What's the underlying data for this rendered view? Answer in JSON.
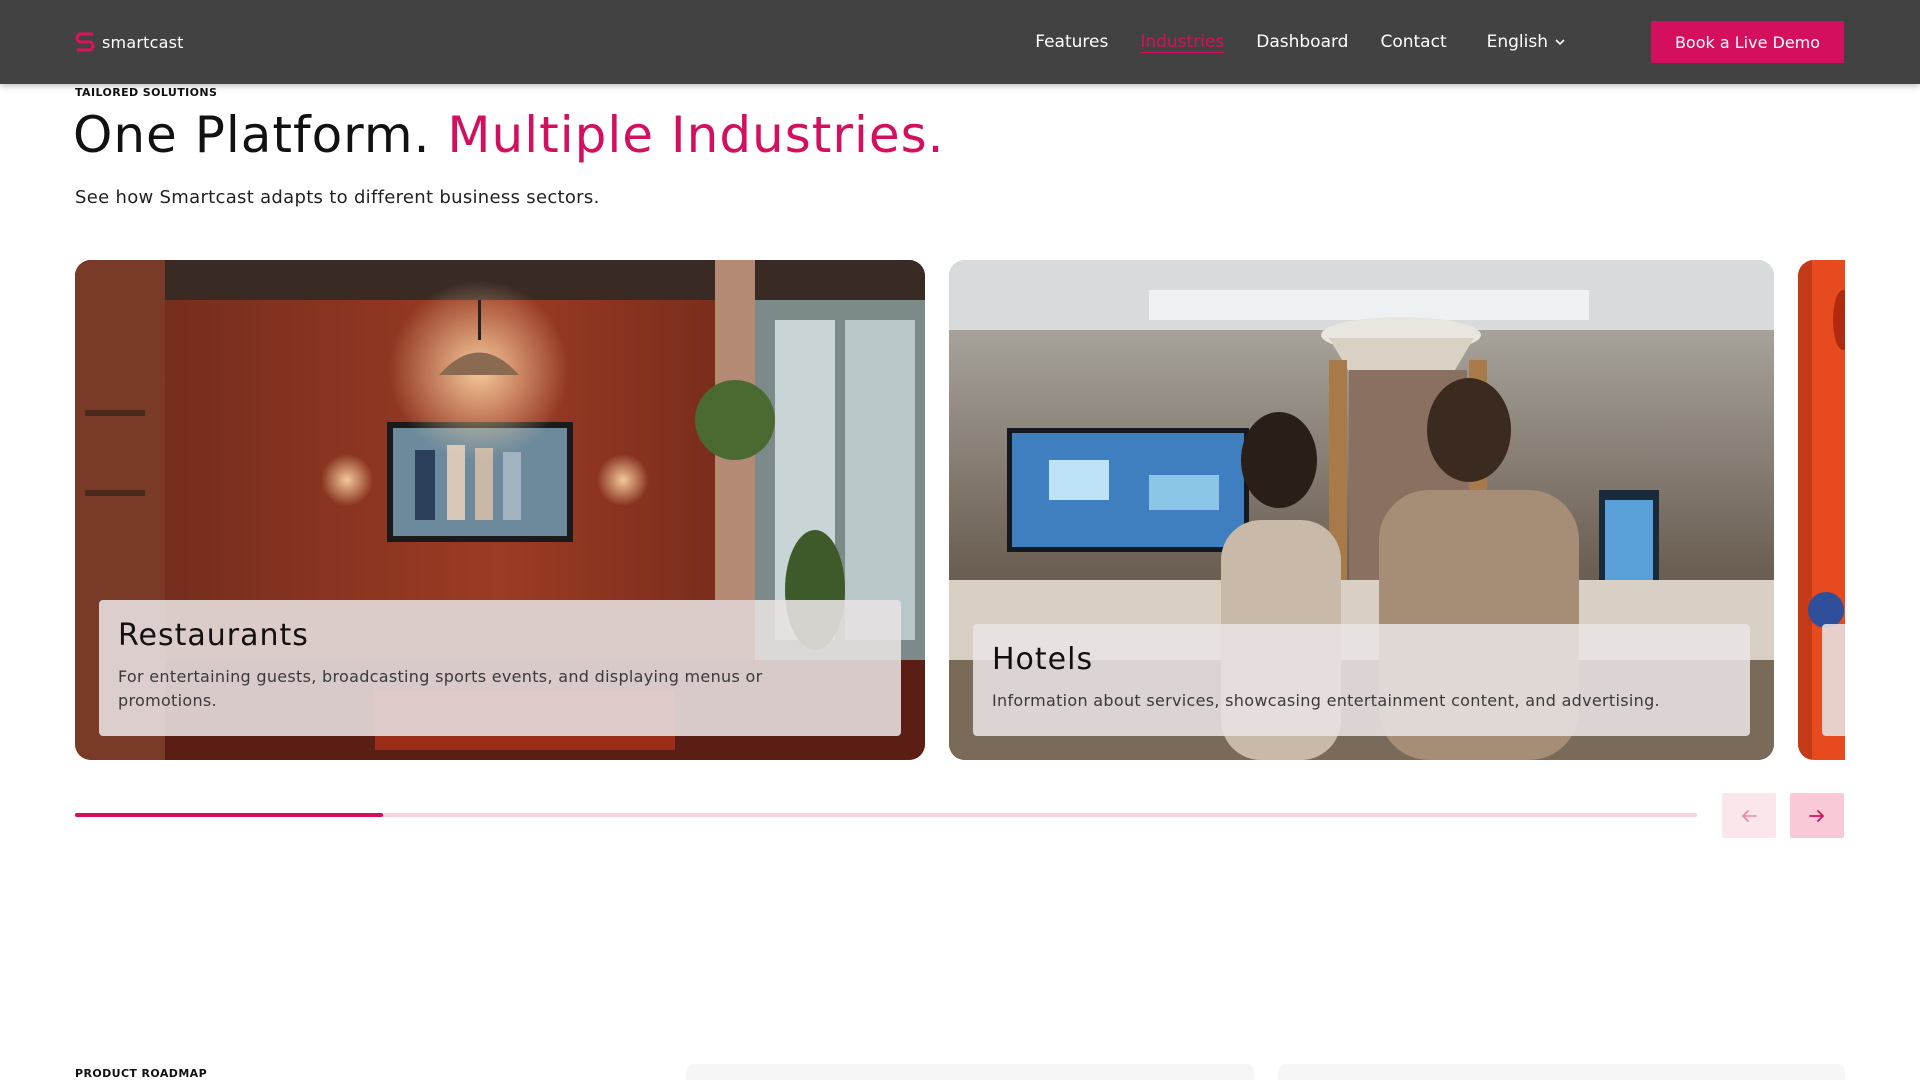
{
  "nav": {
    "logo_text": "smartcast",
    "links": [
      "Features",
      "Industries",
      "Dashboard",
      "Contact"
    ],
    "active_link": "Industries",
    "language": "English",
    "cta": "Book a Live Demo"
  },
  "hero": {
    "eyebrow": "TAILORED SOLUTIONS",
    "headline_plain": "One Platform.",
    "headline_accent": "Multiple Industries.",
    "subtitle": "See how Smartcast adapts to different business sectors."
  },
  "industries": [
    {
      "title": "Restaurants",
      "description": "For entertaining guests, broadcasting sports events, and displaying menus or promotions."
    },
    {
      "title": "Hotels",
      "description": "Information about services, showcasing entertainment content, and advertising."
    }
  ],
  "carousel": {
    "progress": 0.19
  },
  "next_section": {
    "eyebrow": "PRODUCT ROADMAP"
  },
  "colors": {
    "accent": "#d4105e",
    "nav_bg": "#424242"
  }
}
